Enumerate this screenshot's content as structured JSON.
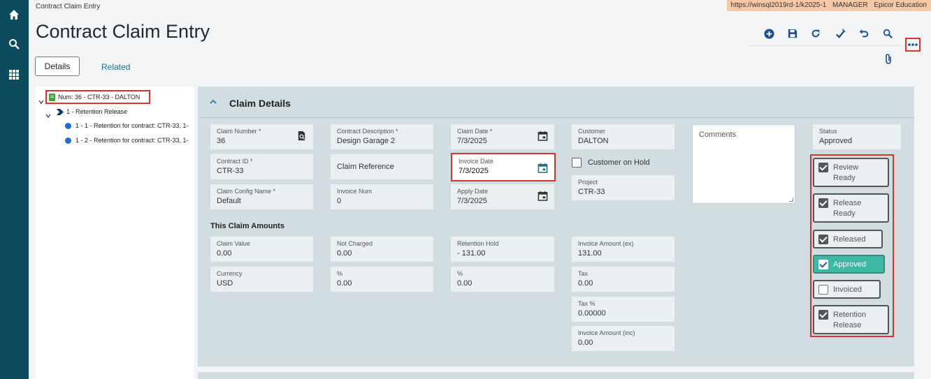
{
  "app": {
    "breadcrumb": "Contract Claim Entry",
    "page_title": "Contract Claim Entry",
    "env": {
      "url": "https://winsql2019rd-1/k2025-1",
      "user": "MANAGER",
      "company": "Epicor Education"
    }
  },
  "nav_icons": [
    "home-icon",
    "search-icon",
    "apps-grid-icon"
  ],
  "toolbar_icons": [
    "add-new-icon",
    "save-icon",
    "refresh-icon",
    "clear-icon",
    "undo-icon",
    "search-icon"
  ],
  "tabs": {
    "details": "Details",
    "related": "Related"
  },
  "tree": {
    "root": "Num: 36 - CTR-33 - DALTON",
    "node": "1 - Retention Release",
    "leaves": [
      "1 - 1 - Retention for contract: CTR-33, 1-",
      "1 - 2 - Retention for contract: CTR-33, 1-"
    ]
  },
  "panel": {
    "title": "Claim Details",
    "claim_number": {
      "label": "Claim Number *",
      "value": "36"
    },
    "contract_description": {
      "label": "Contract Description *",
      "value": "Design Garage 2"
    },
    "claim_date": {
      "label": "Claim Date *",
      "value": "7/3/2025"
    },
    "customer": {
      "label": "Customer",
      "value": "DALTON"
    },
    "status": {
      "label": "Status",
      "value": "Approved"
    },
    "contract_id": {
      "label": "Contract ID *",
      "value": "CTR-33"
    },
    "claim_reference": {
      "label": "Claim Reference"
    },
    "invoice_date": {
      "label": "Invoice Date",
      "value": "7/3/2025"
    },
    "customer_on_hold": {
      "label": "Customer on Hold",
      "checked": false
    },
    "project": {
      "label": "Project",
      "value": "CTR-33"
    },
    "claim_config_name": {
      "label": "Claim Config Name *",
      "value": "Default"
    },
    "invoice_num": {
      "label": "Invoice Num",
      "value": "0"
    },
    "apply_date": {
      "label": "Apply Date",
      "value": "7/3/2025"
    },
    "comments": {
      "placeholder": "Comments"
    },
    "amounts_section": "This Claim Amounts",
    "claim_value": {
      "label": "Claim Value",
      "value": "0.00"
    },
    "not_charged": {
      "label": "Not Charged",
      "value": "0.00"
    },
    "retention_hold": {
      "label": "Retention Hold",
      "value": "- 131.00"
    },
    "invoice_amount_ex": {
      "label": "Invoice Amount (ex)",
      "value": "131.00"
    },
    "currency": {
      "label": "Currency",
      "value": "USD"
    },
    "not_charged_pct": {
      "label": "%",
      "value": "0.00"
    },
    "retention_pct": {
      "label": "%",
      "value": "0.00"
    },
    "tax": {
      "label": "Tax",
      "value": "0.00"
    },
    "tax_pct": {
      "label": "Tax %",
      "value": "0.00000"
    },
    "invoice_amount_inc": {
      "label": "Invoice Amount (inc)",
      "value": "0.00"
    }
  },
  "status_buttons": [
    {
      "l1": "Review",
      "l2": "Ready",
      "checked": true,
      "active": false
    },
    {
      "l1": "Release",
      "l2": "Ready",
      "checked": true,
      "active": false
    },
    {
      "l1": "Released",
      "l2": "",
      "checked": true,
      "active": false
    },
    {
      "l1": "Approved",
      "l2": "",
      "checked": true,
      "active": true
    },
    {
      "l1": "Invoiced",
      "l2": "",
      "checked": false,
      "active": false
    },
    {
      "l1": "Retention",
      "l2": "Release",
      "checked": true,
      "active": false
    }
  ],
  "colors": {
    "nav": "#0c4b5e",
    "accent": "#1a6f8e",
    "highlight": "#d9332b",
    "approved": "#3db8a4"
  }
}
